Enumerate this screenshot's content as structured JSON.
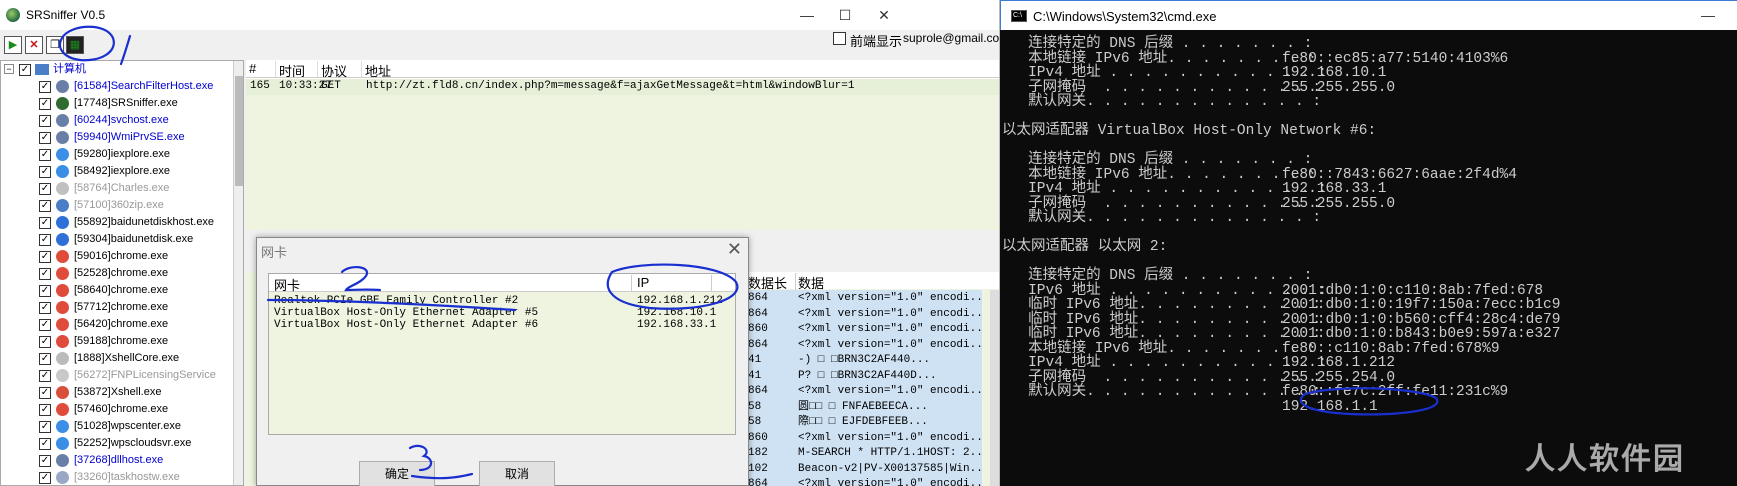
{
  "srs": {
    "title": "SRSniffer V0.5",
    "minimize": "—",
    "maximize": "☐",
    "close": "✕",
    "toolbar": {
      "start_glyph": "▶",
      "stop_glyph": "✕",
      "copy_glyph": "❐",
      "nic_glyph": "▦"
    },
    "front_display_label": "前端显示",
    "email": "suprole@gmail.co",
    "tree": {
      "root": "计算机",
      "items": [
        {
          "text": "[61584]SearchFilterHost.exe",
          "style": "blue",
          "icon": "#6a7fa8"
        },
        {
          "text": "[17748]SRSniffer.exe",
          "style": "normal",
          "icon": "#2e6b2e"
        },
        {
          "text": "[60244]svchost.exe",
          "style": "blue",
          "icon": "#6a7fa8"
        },
        {
          "text": "[59940]WmiPrvSE.exe",
          "style": "blue",
          "icon": "#6a7fa8"
        },
        {
          "text": "[59280]iexplore.exe",
          "style": "normal",
          "icon": "#3a8ee6"
        },
        {
          "text": "[58492]iexplore.exe",
          "style": "normal",
          "icon": "#3a8ee6"
        },
        {
          "text": "[58764]Charles.exe",
          "style": "gray",
          "icon": "#c0c0c0"
        },
        {
          "text": "[57100]360zip.exe",
          "style": "gray",
          "icon": "#4a7fc8"
        },
        {
          "text": "[55892]baidunetdiskhost.exe",
          "style": "normal",
          "icon": "#2f6fd8"
        },
        {
          "text": "[59304]baidunetdisk.exe",
          "style": "normal",
          "icon": "#2f6fd8"
        },
        {
          "text": "[59016]chrome.exe",
          "style": "normal",
          "icon": "#e04c3c"
        },
        {
          "text": "[52528]chrome.exe",
          "style": "normal",
          "icon": "#e04c3c"
        },
        {
          "text": "[58640]chrome.exe",
          "style": "normal",
          "icon": "#e04c3c"
        },
        {
          "text": "[57712]chrome.exe",
          "style": "normal",
          "icon": "#e04c3c"
        },
        {
          "text": "[56420]chrome.exe",
          "style": "normal",
          "icon": "#e04c3c"
        },
        {
          "text": "[59188]chrome.exe",
          "style": "normal",
          "icon": "#e04c3c"
        },
        {
          "text": "[1888]XshellCore.exe",
          "style": "normal",
          "icon": "#bbbbbb"
        },
        {
          "text": "[56272]FNPLicensingService",
          "style": "gray",
          "icon": "#c8c8c8"
        },
        {
          "text": "[53872]Xshell.exe",
          "style": "normal",
          "icon": "#d8503a"
        },
        {
          "text": "[57460]chrome.exe",
          "style": "normal",
          "icon": "#e04c3c"
        },
        {
          "text": "[51028]wpscenter.exe",
          "style": "normal",
          "icon": "#3a8ee6"
        },
        {
          "text": "[52252]wpscloudsvr.exe",
          "style": "normal",
          "icon": "#3a8ee6"
        },
        {
          "text": "[37268]dllhost.exe",
          "style": "blue",
          "icon": "#6a7fa8"
        },
        {
          "text": "[33260]taskhostw.exe",
          "style": "gray",
          "icon": "#9aa8c8"
        }
      ]
    },
    "list": {
      "headers": [
        "#",
        "时间",
        "协议",
        "地址"
      ],
      "rows": [
        {
          "num": "165",
          "time": "10:33:27",
          "proto": "GET",
          "url": "http://zt.fld8.cn/index.php?m=message&f=ajaxGetMessage&t=html&windowBlur=1"
        }
      ]
    },
    "lower": {
      "headers": [
        "数据长度",
        "数据"
      ],
      "rows": [
        {
          "len": "864",
          "data": "<?xml version=\"1.0\" encodi..."
        },
        {
          "len": "864",
          "data": "<?xml version=\"1.0\" encodi..."
        },
        {
          "len": "860",
          "data": "<?xml version=\"1.0\" encodi..."
        },
        {
          "len": "864",
          "data": "<?xml version=\"1.0\" encodi..."
        },
        {
          "len": "41",
          "data": "-)  □      □BRN3C2AF440..."
        },
        {
          "len": "41",
          "data": "P?  □       □BRN3C2AF440D..."
        },
        {
          "len": "864",
          "data": "<?xml version=\"1.0\" encodi..."
        },
        {
          "len": "58",
          "data": "圆□□ □      FNFAEBEECA..."
        },
        {
          "len": "58",
          "data": "際□□ □      EJFDEBFEEB..."
        },
        {
          "len": "860",
          "data": "<?xml version=\"1.0\" encodi..."
        },
        {
          "len": "182",
          "data": "M-SEARCH * HTTP/1.1HOST: 2..."
        },
        {
          "len": "102",
          "data": "Beacon-v2|PV-X00137585|Win..."
        },
        {
          "len": "864",
          "data": "<?xml version=\"1.0\" encodi..."
        }
      ]
    },
    "dialog": {
      "title": "网卡",
      "close": "✕",
      "headers": [
        "网卡",
        "IP"
      ],
      "rows": [
        {
          "name": "Realtek PCIe GBE Family Controller #2",
          "ip": "192.168.1.212"
        },
        {
          "name": "VirtualBox Host-Only Ethernet Adapter #5",
          "ip": "192.168.10.1"
        },
        {
          "name": "VirtualBox Host-Only Ethernet Adapter #6",
          "ip": "192.168.33.1"
        }
      ],
      "ok": "确定",
      "cancel": "取消"
    }
  },
  "cmd": {
    "title": "C:\\Windows\\System32\\cmd.exe",
    "icon_text": "C:\\",
    "minimize": "—",
    "lines": [
      {
        "label": "   连接特定的 DNS 后缀 . . . . . . . :",
        "value": ""
      },
      {
        "label": "   本地链接 IPv6 地址. . . . . . . . :",
        "value": "fe80::ec85:a77:5140:4103%6"
      },
      {
        "label": "   IPv4 地址 . . . . . . . . . . . . :",
        "value": "192.168.10.1"
      },
      {
        "label": "   子网掩码  . . . . . . . . . . . . :",
        "value": "255.255.255.0"
      },
      {
        "label": "   默认网关. . . . . . . . . . . . . :",
        "value": ""
      },
      {
        "label": "",
        "value": ""
      },
      {
        "label": "以太网适配器 VirtualBox Host-Only Network #6:",
        "value": ""
      },
      {
        "label": "",
        "value": ""
      },
      {
        "label": "   连接特定的 DNS 后缀 . . . . . . . :",
        "value": ""
      },
      {
        "label": "   本地链接 IPv6 地址. . . . . . . . :",
        "value": "fe80::7843:6627:6aae:2f4d%4"
      },
      {
        "label": "   IPv4 地址 . . . . . . . . . . . . :",
        "value": "192.168.33.1"
      },
      {
        "label": "   子网掩码  . . . . . . . . . . . . :",
        "value": "255.255.255.0"
      },
      {
        "label": "   默认网关. . . . . . . . . . . . . :",
        "value": ""
      },
      {
        "label": "",
        "value": ""
      },
      {
        "label": "以太网适配器 以太网 2:",
        "value": ""
      },
      {
        "label": "",
        "value": ""
      },
      {
        "label": "   连接特定的 DNS 后缀 . . . . . . . :",
        "value": ""
      },
      {
        "label": "   IPv6 地址 . . . . . . . . . . . . :",
        "value": "2001:db0:1:0:c110:8ab:7fed:678"
      },
      {
        "label": "   临时 IPv6 地址. . . . . . . . . . :",
        "value": "2001:db0:1:0:19f7:150a:7ecc:b1c9"
      },
      {
        "label": "   临时 IPv6 地址. . . . . . . . . . :",
        "value": "2001:db0:1:0:b560:cff4:28c4:de79"
      },
      {
        "label": "   临时 IPv6 地址. . . . . . . . . . :",
        "value": "2001:db0:1:0:b843:b0e9:597a:e327"
      },
      {
        "label": "   本地链接 IPv6 地址. . . . . . . . :",
        "value": "fe80::c110:8ab:7fed:678%9"
      },
      {
        "label": "   IPv4 地址 . . . . . . . . . . . . :",
        "value": "192.168.1.212"
      },
      {
        "label": "   子网掩码  . . . . . . . . . . . . :",
        "value": "255.255.254.0"
      },
      {
        "label": "   默认网关. . . . . . . . . . . . . :",
        "value": "fe80::fe7c:2ff:fe11:231c%9"
      },
      {
        "label": "",
        "value": "192.168.1.1"
      }
    ]
  },
  "watermark": "人人软件园",
  "colors": {
    "annotation": "#1a2fd0",
    "list_bg": "#eef4e0",
    "selected_cell": "#cfe2f4"
  }
}
